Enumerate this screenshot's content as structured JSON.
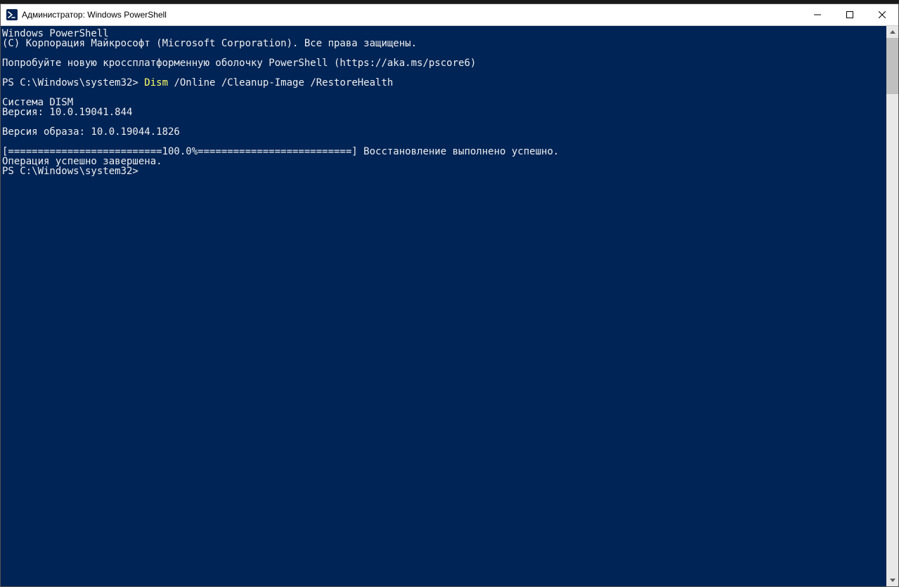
{
  "window": {
    "title": "Администратор: Windows PowerShell"
  },
  "console": {
    "header1": "Windows PowerShell",
    "header2": "(C) Корпорация Майкрософт (Microsoft Corporation). Все права защищены.",
    "tryline": "Попробуйте новую кроссплатформенную оболочку PowerShell (https://aka.ms/pscore6)",
    "prompt1_prefix": "PS C:\\Windows\\system32> ",
    "cmd_name": "Dism ",
    "cmd_args": "/Online /Cleanup-Image /RestoreHealth",
    "dism_system": "Cистема DISM",
    "dism_version": "Версия: 10.0.19041.844",
    "image_version": "Версия образа: 10.0.19044.1826",
    "progress": "[==========================100.0%==========================] Восстановление выполнено успешно.",
    "op_done": "Операция успешно завершена.",
    "prompt2": "PS C:\\Windows\\system32>"
  }
}
